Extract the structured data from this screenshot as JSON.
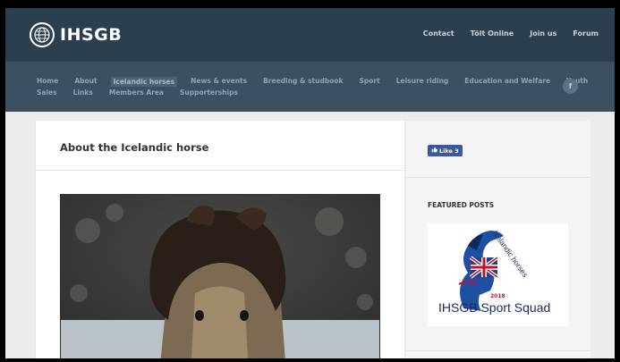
{
  "site": {
    "name": "IHSGB"
  },
  "top_links": [
    "Contact",
    "Tölt Online",
    "Join us",
    "Forum"
  ],
  "nav": {
    "row1": [
      "Home",
      "About",
      "Icelandic horses",
      "News & events",
      "Breeding & studbook",
      "Sport",
      "Leisure riding",
      "Education and Welfare",
      "Youth"
    ],
    "row2": [
      "Sales",
      "Links",
      "Members Area",
      "Supporterships"
    ],
    "active": "Icelandic horses",
    "facebook_icon": "f"
  },
  "main": {
    "title": "About the Icelandic horse"
  },
  "sidebar": {
    "fb_like_label": "Like 3",
    "featured_title": "FEATURED POSTS",
    "featured_image": {
      "arc_text": "Icelandic horses",
      "year": "2018",
      "caption": "IHSGB Sport Squad"
    }
  },
  "colors": {
    "topbar": "#2b3f4f",
    "navbar": "#3b5162",
    "fb_blue": "#3b5998",
    "flag_red": "#c8102e",
    "navy": "#1a2a5e"
  }
}
